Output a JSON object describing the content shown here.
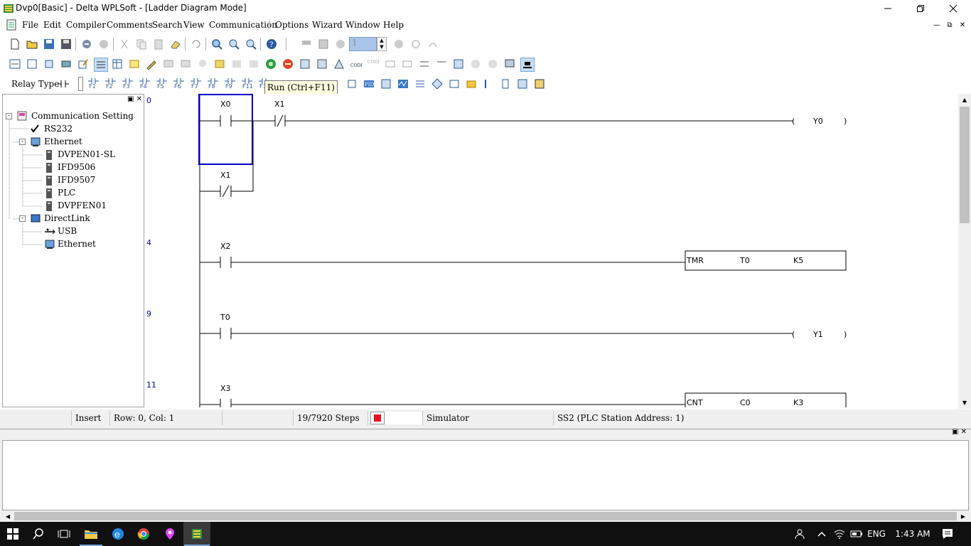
{
  "window": {
    "title": "Dvp0[Basic] - Delta WPLSoft - [Ladder Diagram Mode]"
  },
  "menu": [
    "File",
    "Edit",
    "Compiler",
    "Comments",
    "Search",
    "View",
    "Communication",
    "Options",
    "Wizard",
    "Window",
    "Help"
  ],
  "toolbar1": {
    "step_value": "1"
  },
  "toolbar3": {
    "relay_type_label": "Relay Type",
    "fkeys": [
      "F1",
      "F2",
      "F3",
      "F4",
      "F5",
      "F6",
      "F7",
      "F8",
      "F9",
      "F11",
      "F12"
    ]
  },
  "tooltip": {
    "text": "Run (Ctrl+F11)"
  },
  "tree": {
    "root": "Communication Setting",
    "rs232": "RS232",
    "ethernet": "Ethernet",
    "ethernet_children": [
      "DVPEN01-SL",
      "IFD9506",
      "IFD9507",
      "PLC",
      "DVPFEN01"
    ],
    "directlink": "DirectLink",
    "directlink_children": [
      "USB",
      "Ethernet"
    ]
  },
  "ladder": {
    "step_numbers": [
      "0",
      "4",
      "9",
      "11"
    ],
    "contacts": [
      "X0",
      "X1",
      "X1",
      "X2",
      "T0",
      "X3"
    ],
    "coils": [
      "Y0",
      "Y1"
    ],
    "instructions": [
      {
        "op": "TMR",
        "a": "T0",
        "b": "K5"
      },
      {
        "op": "CNT",
        "a": "C0",
        "b": "K3"
      }
    ]
  },
  "status": {
    "mode": "Insert",
    "position": "Row: 0, Col: 1",
    "steps": "19/7920 Steps",
    "connection": "Simulator",
    "station": "SS2 (PLC Station Address: 1)"
  },
  "taskbar": {
    "language": "ENG",
    "time": "1:43 AM"
  },
  "colors": {
    "selection": "#0000cc",
    "step_number": "#0000a0",
    "status_red": "#e81123",
    "taskbar": "#101010"
  }
}
